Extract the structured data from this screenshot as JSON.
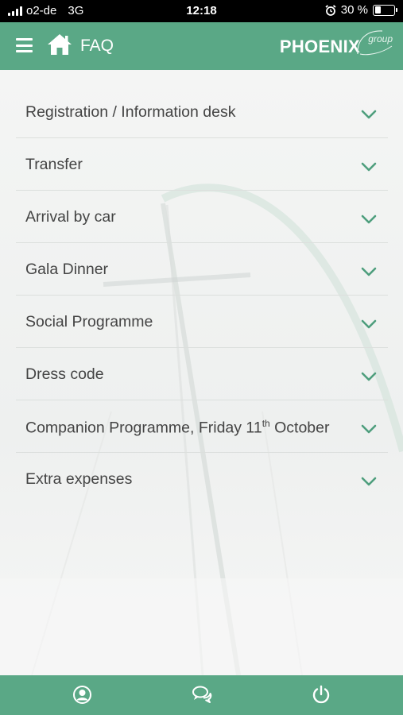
{
  "status_bar": {
    "carrier": "o2-de",
    "network": "3G",
    "time": "12:18",
    "battery": "30 %",
    "battery_level": 0.3
  },
  "header": {
    "title": "FAQ",
    "brand": "PHOENIX",
    "brand_sub": "group",
    "menu_icon": "menu-icon",
    "home_icon": "home-icon"
  },
  "faq": {
    "items": [
      {
        "label": "Registration / Information desk"
      },
      {
        "label": "Transfer"
      },
      {
        "label": "Arrival by car"
      },
      {
        "label": "Gala Dinner"
      },
      {
        "label": "Social Programme"
      },
      {
        "label": "Dress code"
      },
      {
        "label_pre": "Companion Programme, Friday 11",
        "label_sup": "th",
        "label_post": " October"
      },
      {
        "label": "Extra expenses"
      }
    ]
  },
  "footer": {
    "icons": [
      "profile-icon",
      "chat-icon",
      "power-icon"
    ]
  },
  "colors": {
    "accent": "#5aa886",
    "chevron": "#4e9e7d",
    "text": "#444444"
  }
}
